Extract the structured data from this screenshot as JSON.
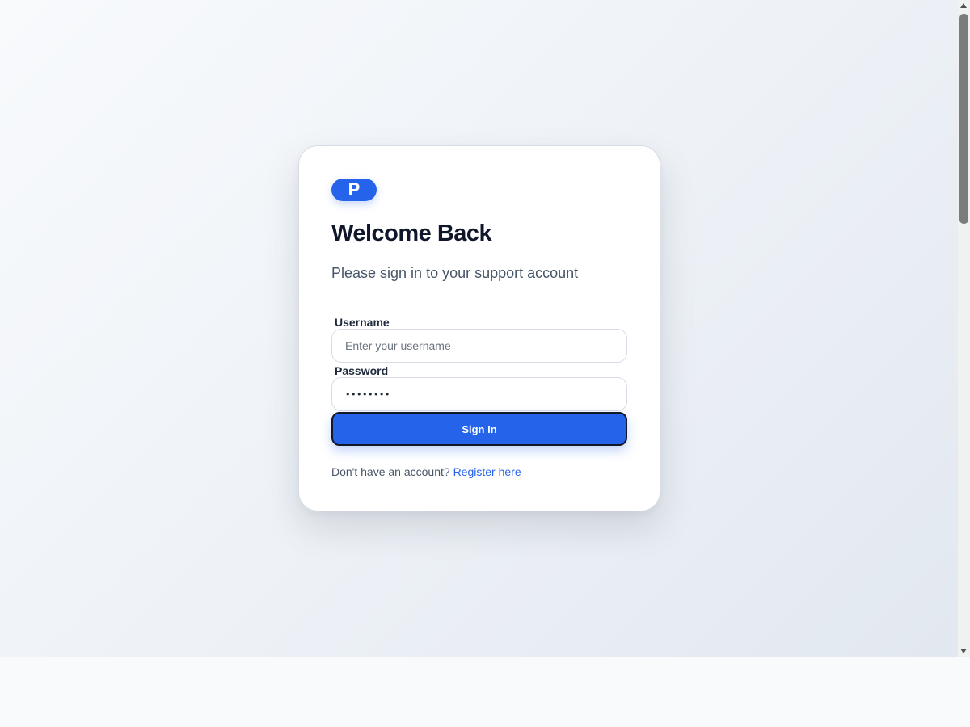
{
  "brand": {
    "logo_letter": "P"
  },
  "login": {
    "title": "Welcome Back",
    "subtitle": "Please sign in to your support account",
    "username_label": "Username",
    "username_placeholder": "Enter your username",
    "username_value": "",
    "password_label": "Password",
    "password_value": "••••••••",
    "submit_label": "Sign In",
    "register_prompt": "Don't have an account?",
    "register_link": "Register here"
  },
  "colors": {
    "accent": "#2563eb",
    "title": "#0f172a",
    "muted": "#475569",
    "background": "#f1f5f9"
  }
}
